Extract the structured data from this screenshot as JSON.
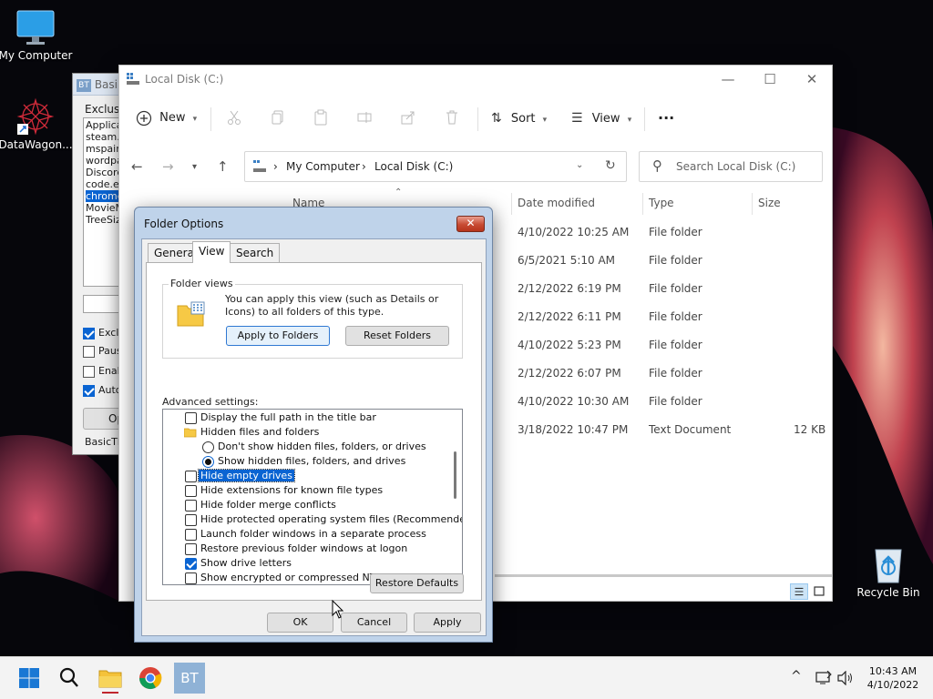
{
  "desktop": {
    "icons": [
      {
        "label": "My Computer"
      },
      {
        "label": "DataWagon..."
      },
      {
        "label": "Recycle Bin"
      }
    ]
  },
  "basic_themer": {
    "title": "Basi",
    "logo": "BT",
    "exclusions_label": "Exclusio",
    "list_items": [
      "Applica",
      "steam.e",
      "mspaint",
      "wordpa",
      "Discord",
      "code.ex",
      "chrome",
      "MovieM",
      "TreeSiz"
    ],
    "selected_item": "chrome",
    "checkboxes": [
      {
        "label": "Exclu",
        "checked": true
      },
      {
        "label": "Paus",
        "checked": false
      },
      {
        "label": "Enab",
        "checked": false
      },
      {
        "label": "Auto",
        "checked": true
      }
    ],
    "button_label": "Op",
    "footer": "BasicTh"
  },
  "explorer": {
    "title": "Local Disk (C:)",
    "window_buttons": {
      "minimize": "—",
      "maximize": "☐",
      "close": "✕"
    },
    "toolbar": {
      "new": "New",
      "sort": "Sort",
      "view": "View",
      "more": "···"
    },
    "breadcrumb": [
      "My Computer",
      "Local Disk (C:)"
    ],
    "search_placeholder": "Search Local Disk (C:)",
    "columns": {
      "name": "Name",
      "date": "Date modified",
      "type": "Type",
      "size": "Size"
    },
    "rows": [
      {
        "date": "4/10/2022 10:25 AM",
        "type": "File folder",
        "size": ""
      },
      {
        "date": "6/5/2021 5:10 AM",
        "type": "File folder",
        "size": ""
      },
      {
        "date": "2/12/2022 6:19 PM",
        "type": "File folder",
        "size": ""
      },
      {
        "date": "2/12/2022 6:11 PM",
        "type": "File folder",
        "size": ""
      },
      {
        "date": "4/10/2022 5:23 PM",
        "type": "File folder",
        "size": ""
      },
      {
        "date": "2/12/2022 6:07 PM",
        "type": "File folder",
        "size": ""
      },
      {
        "date": "4/10/2022 10:30 AM",
        "type": "File folder",
        "size": ""
      },
      {
        "date": "3/18/2022 10:47 PM",
        "type": "Text Document",
        "size": "12 KB"
      }
    ]
  },
  "dialog": {
    "title": "Folder Options",
    "close": "✕",
    "tabs": [
      "General",
      "View",
      "Search"
    ],
    "active_tab": "View",
    "folder_views": {
      "title": "Folder views",
      "text": "You can apply this view (such as Details or Icons) to all folders of this type.",
      "apply_button": "Apply to Folders",
      "reset_button": "Reset Folders"
    },
    "advanced_label": "Advanced settings:",
    "settings": [
      {
        "kind": "check",
        "label": "Display the full path in the title bar",
        "checked": false,
        "indent": 0,
        "selected": false
      },
      {
        "kind": "folder",
        "label": "Hidden files and folders",
        "checked": false,
        "indent": 0,
        "selected": false
      },
      {
        "kind": "radio",
        "label": "Don't show hidden files, folders, or drives",
        "checked": false,
        "indent": 1,
        "selected": false
      },
      {
        "kind": "radio",
        "label": "Show hidden files, folders, and drives",
        "checked": true,
        "indent": 1,
        "selected": false
      },
      {
        "kind": "check",
        "label": "Hide empty drives",
        "checked": false,
        "indent": 0,
        "selected": true
      },
      {
        "kind": "check",
        "label": "Hide extensions for known file types",
        "checked": false,
        "indent": 0,
        "selected": false
      },
      {
        "kind": "check",
        "label": "Hide folder merge conflicts",
        "checked": false,
        "indent": 0,
        "selected": false
      },
      {
        "kind": "check",
        "label": "Hide protected operating system files (Recommended)",
        "checked": false,
        "indent": 0,
        "selected": false
      },
      {
        "kind": "check",
        "label": "Launch folder windows in a separate process",
        "checked": false,
        "indent": 0,
        "selected": false
      },
      {
        "kind": "check",
        "label": "Restore previous folder windows at logon",
        "checked": false,
        "indent": 0,
        "selected": false
      },
      {
        "kind": "check",
        "label": "Show drive letters",
        "checked": true,
        "indent": 0,
        "selected": false
      },
      {
        "kind": "check",
        "label": "Show encrypted or compressed NTFS files in color",
        "checked": false,
        "indent": 0,
        "selected": false
      }
    ],
    "restore_defaults": "Restore Defaults",
    "ok": "OK",
    "cancel": "Cancel",
    "apply": "Apply"
  },
  "taskbar": {
    "time": "10:43 AM",
    "date": "4/10/2022",
    "bt_label": "BT"
  },
  "colors": {
    "accent": "#0a64d2",
    "dialog_frame": "#bfd3ea",
    "taskbar": "#f3f3f3"
  }
}
